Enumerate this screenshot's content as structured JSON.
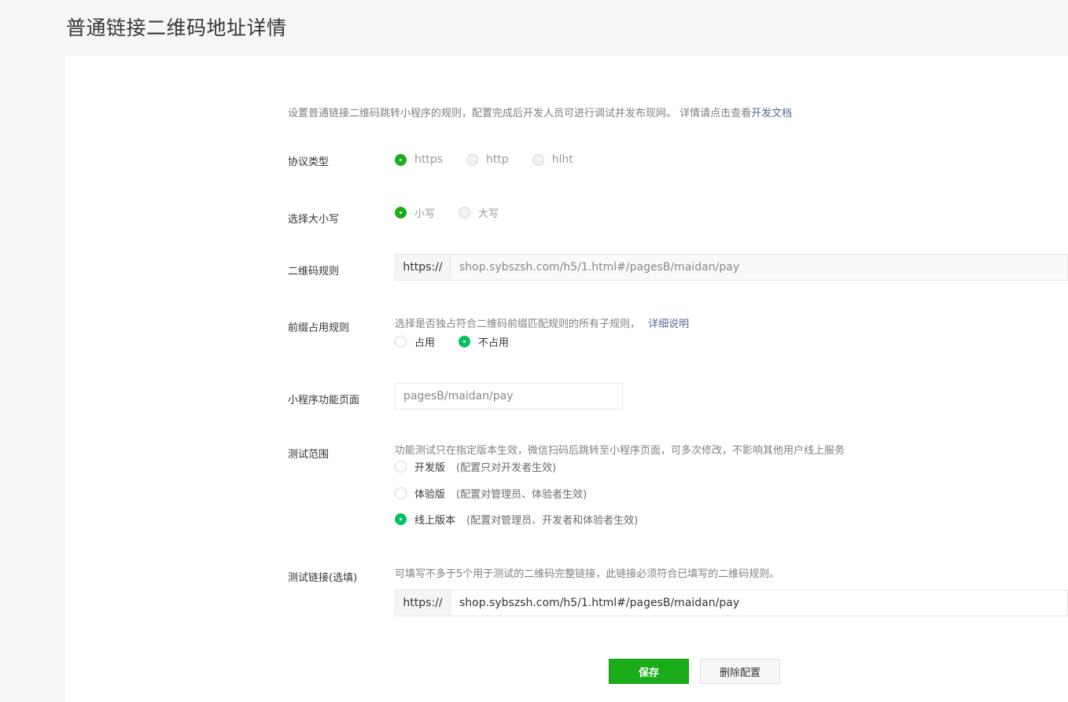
{
  "page": {
    "title": "普通链接二维码地址详情"
  },
  "intro": {
    "text": "设置普通链接二维码跳转小程序的规则，配置完成后开发人员可进行调试并发布现网。 详情请点击查看",
    "link": "开发文档"
  },
  "protocol": {
    "label": "协议类型",
    "options": [
      "https",
      "http",
      "hlht"
    ],
    "selected": "https"
  },
  "case": {
    "label": "选择大小写",
    "options": [
      "小写",
      "大写"
    ],
    "selected": "小写"
  },
  "qr_rule": {
    "label": "二维码规则",
    "prefix": "https://",
    "value": "shop.sybszsh.com/h5/1.html#/pagesB/maidan/pay"
  },
  "prefix_rule": {
    "label": "前缀占用规则",
    "hint": "选择是否独占符合二维码前缀匹配规则的所有子规则，",
    "link": "详细说明",
    "options": [
      "占用",
      "不占用"
    ],
    "selected": "不占用"
  },
  "page_path": {
    "label": "小程序功能页面",
    "value": "pagesB/maidan/pay"
  },
  "test_scope": {
    "label": "测试范围",
    "hint": "功能测试只在指定版本生效，微信扫码后跳转至小程序页面，可多次修改，不影响其他用户线上服务",
    "options": [
      {
        "name": "开发版",
        "note": "(配置只对开发者生效)"
      },
      {
        "name": "体验版",
        "note": "(配置对管理员、体验者生效)"
      },
      {
        "name": "线上版本",
        "note": "(配置对管理员、开发者和体验者生效)"
      }
    ],
    "selected": "线上版本"
  },
  "test_link": {
    "label": "测试链接(选填)",
    "hint": "可填写不多于5个用于测试的二维码完整链接，此链接必须符合已填写的二维码规则。",
    "prefix": "https://",
    "value": "shop.sybszsh.com/h5/1.html#/pagesB/maidan/pay"
  },
  "actions": {
    "save": "保存",
    "delete": "删除配置"
  },
  "colors": {
    "primary": "#1aad19",
    "link": "#576b95",
    "radio_active": "#07c160"
  }
}
